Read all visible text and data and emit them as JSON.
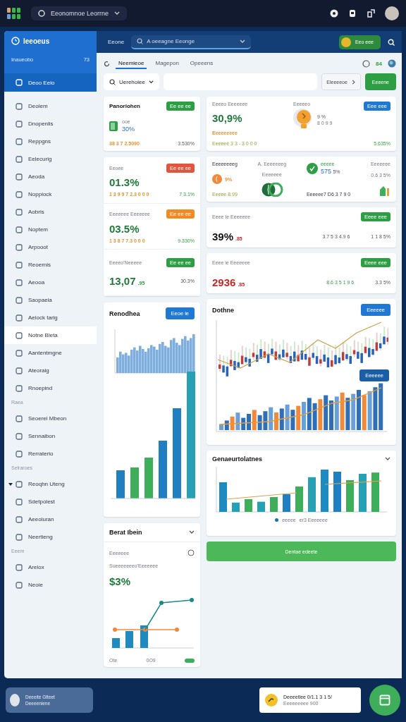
{
  "topbar": {
    "title": "Eeonomnoe Leorrne"
  },
  "sidebar": {
    "title": "Ieeoeus",
    "subtitle": "Inaueobo",
    "count": "73",
    "items": [
      {
        "kind": "item",
        "label": "Deoo Eeio",
        "selected": true,
        "highlighted": false
      },
      {
        "kind": "item",
        "label": "Deolem",
        "selected": false,
        "highlighted": false
      },
      {
        "kind": "item",
        "label": "Dnopenlis",
        "selected": false,
        "highlighted": false
      },
      {
        "kind": "item",
        "label": "Reppgns",
        "selected": false,
        "highlighted": false
      },
      {
        "kind": "item",
        "label": "Eelecurig",
        "selected": false,
        "highlighted": false
      },
      {
        "kind": "item",
        "label": "Aeoda",
        "selected": false,
        "highlighted": false
      },
      {
        "kind": "item",
        "label": "Noppiock",
        "selected": false,
        "highlighted": false
      },
      {
        "kind": "item",
        "label": "Aobris",
        "selected": false,
        "highlighted": false
      },
      {
        "kind": "item",
        "label": "Noptem",
        "selected": false,
        "highlighted": false
      },
      {
        "kind": "item",
        "label": "Arpooot",
        "selected": false,
        "highlighted": false
      },
      {
        "kind": "item",
        "label": "Reoernis",
        "selected": false,
        "highlighted": false
      },
      {
        "kind": "item",
        "label": "Aeooa",
        "selected": false,
        "highlighted": false
      },
      {
        "kind": "item",
        "label": "Saopaeia",
        "selected": false,
        "highlighted": false
      },
      {
        "kind": "item",
        "label": "Aeiock tarig",
        "selected": false,
        "highlighted": false
      },
      {
        "kind": "item",
        "label": "Notne Bleta",
        "selected": false,
        "highlighted": true
      },
      {
        "kind": "item",
        "label": "Aantentmgne",
        "selected": false,
        "highlighted": false
      },
      {
        "kind": "item",
        "label": "Ateoraig",
        "selected": false,
        "highlighted": false
      },
      {
        "kind": "item",
        "label": "Rnoepind",
        "selected": false,
        "highlighted": false
      },
      {
        "kind": "section",
        "label": "Raea"
      },
      {
        "kind": "item",
        "label": "Seoerel Mbeon",
        "selected": false,
        "highlighted": false
      },
      {
        "kind": "item",
        "label": "Sennaibon",
        "selected": false,
        "highlighted": false
      },
      {
        "kind": "item",
        "label": "Rerraterio",
        "selected": false,
        "highlighted": false
      },
      {
        "kind": "section",
        "label": "Selraroes"
      },
      {
        "kind": "item",
        "label": "Reoqhn Uteng",
        "selected": false,
        "highlighted": false,
        "expanded": true
      },
      {
        "kind": "item",
        "label": "Sdetpolest",
        "selected": false,
        "highlighted": false
      },
      {
        "kind": "item",
        "label": "Aeeoluran",
        "selected": false,
        "highlighted": false
      },
      {
        "kind": "item",
        "label": "Neertieng",
        "selected": false,
        "highlighted": false
      },
      {
        "kind": "section",
        "label": "Eeem"
      },
      {
        "kind": "item",
        "label": "Areiox",
        "selected": false,
        "highlighted": false
      },
      {
        "kind": "item",
        "label": "Neoie",
        "selected": false,
        "highlighted": false
      }
    ],
    "user": {
      "name": "Deeeite Gtteet",
      "role": "Deeeeniene"
    }
  },
  "header": {
    "label": "Eeone",
    "dropdown": "A oeeagne Eeonge",
    "action": "Eeo eee"
  },
  "tabs": [
    {
      "label": "Neemieoe",
      "selected": true
    },
    {
      "label": "Magepon",
      "selected": false
    },
    {
      "label": "Opeeens",
      "selected": false
    }
  ],
  "toolbar": {
    "count": "84"
  },
  "filter": {
    "dropdown": "Uerehoiee",
    "select": "Eleeeeoe",
    "button": "Eeeene"
  },
  "left_top": {
    "title": "Panoriohen",
    "badge": "Ee ee ee",
    "note": "ooe",
    "value": "30%",
    "sub": "38 3 7 2.5090",
    "side": "3.530%"
  },
  "left_group": [
    {
      "title": "Eeoee",
      "badge": "Ee ee ee",
      "color": "#e0553b",
      "value": "01.3%",
      "sub": "1 3 9 9 7 2.3 0 0 0",
      "side": "7 3.1%"
    },
    {
      "title": "Eeeeeee Eeeeeee",
      "badge": "Ee ee ee",
      "color": "#f08a24",
      "value": "03.5%",
      "sub": "1 3 8 7 7.3 0 0 0",
      "side": "9.330%"
    },
    {
      "title": "Eeeeo'Neeeee",
      "badge": "Ee ee ee",
      "color": "#2e9e44",
      "value": "13,07",
      "unit": ".95",
      "side": "30.3%"
    }
  ],
  "summary_card": {
    "title": "Eeeeo Eeeeeee",
    "value": "30,9%",
    "line_1": "Eeeeeeeee",
    "line_2": "Eeeeee 3 3 - 3 0 0 0",
    "center_label": "Eeeeeo",
    "percent": "9 %",
    "count": "8 0 9 9",
    "badge": "Eee eee",
    "side": "5.635%"
  },
  "mixed_card": {
    "title": "Eeeeeeeeg",
    "percent": "9%",
    "line": "Eeeee 8.99",
    "mid_title": "A. Eeeeeeeg",
    "mid_sub": "Eeeeeee",
    "tag": "eeeee",
    "value": "575",
    "unit": "5%",
    "detail": "Eeeeee7 D6 3 7 9 0",
    "right_title": "Eeeeeee",
    "right_value": "0.6 3 5%"
  },
  "stat_rows": [
    {
      "title": "Eeee Ie Eeeeeee",
      "badge": "Eeee eee",
      "negative": false,
      "value": "39%",
      "unit": ".85",
      "middle": "3.7 5 3 4.9 6",
      "side": "1 1 8 5%"
    },
    {
      "title": "Eeee ie Eeeeeee",
      "badge": "Eeee eee",
      "negative": true,
      "value": "2936",
      "unit": ".85",
      "middle": "8.6 3 5 1 9 6",
      "side": "3.3 5%"
    }
  ],
  "charts": [
    {
      "title": "Renodhea",
      "button": "Eeoe ie"
    },
    {
      "title": "Dothne",
      "button": "Eeeeee",
      "button_2": "Eeeeee"
    },
    {
      "title": "Genaeurtolatnes",
      "legend": [
        "eeeee",
        "er3 Eeeeeee"
      ]
    }
  ],
  "small_card": {
    "title": "Berat Ibein",
    "label": "Eeeeeee",
    "sublabel": "Sueeeeeeeo'Eeeeeee",
    "value": "$3%",
    "footer_left": "Ote",
    "footer_mid": "0O9",
    "toggle_on": true
  },
  "wide_button": "Dentae edeete",
  "toast": {
    "title": "Deeeetlee 0/1.1 3 1 5/",
    "sub": "Eeeeeeeee 900"
  }
}
